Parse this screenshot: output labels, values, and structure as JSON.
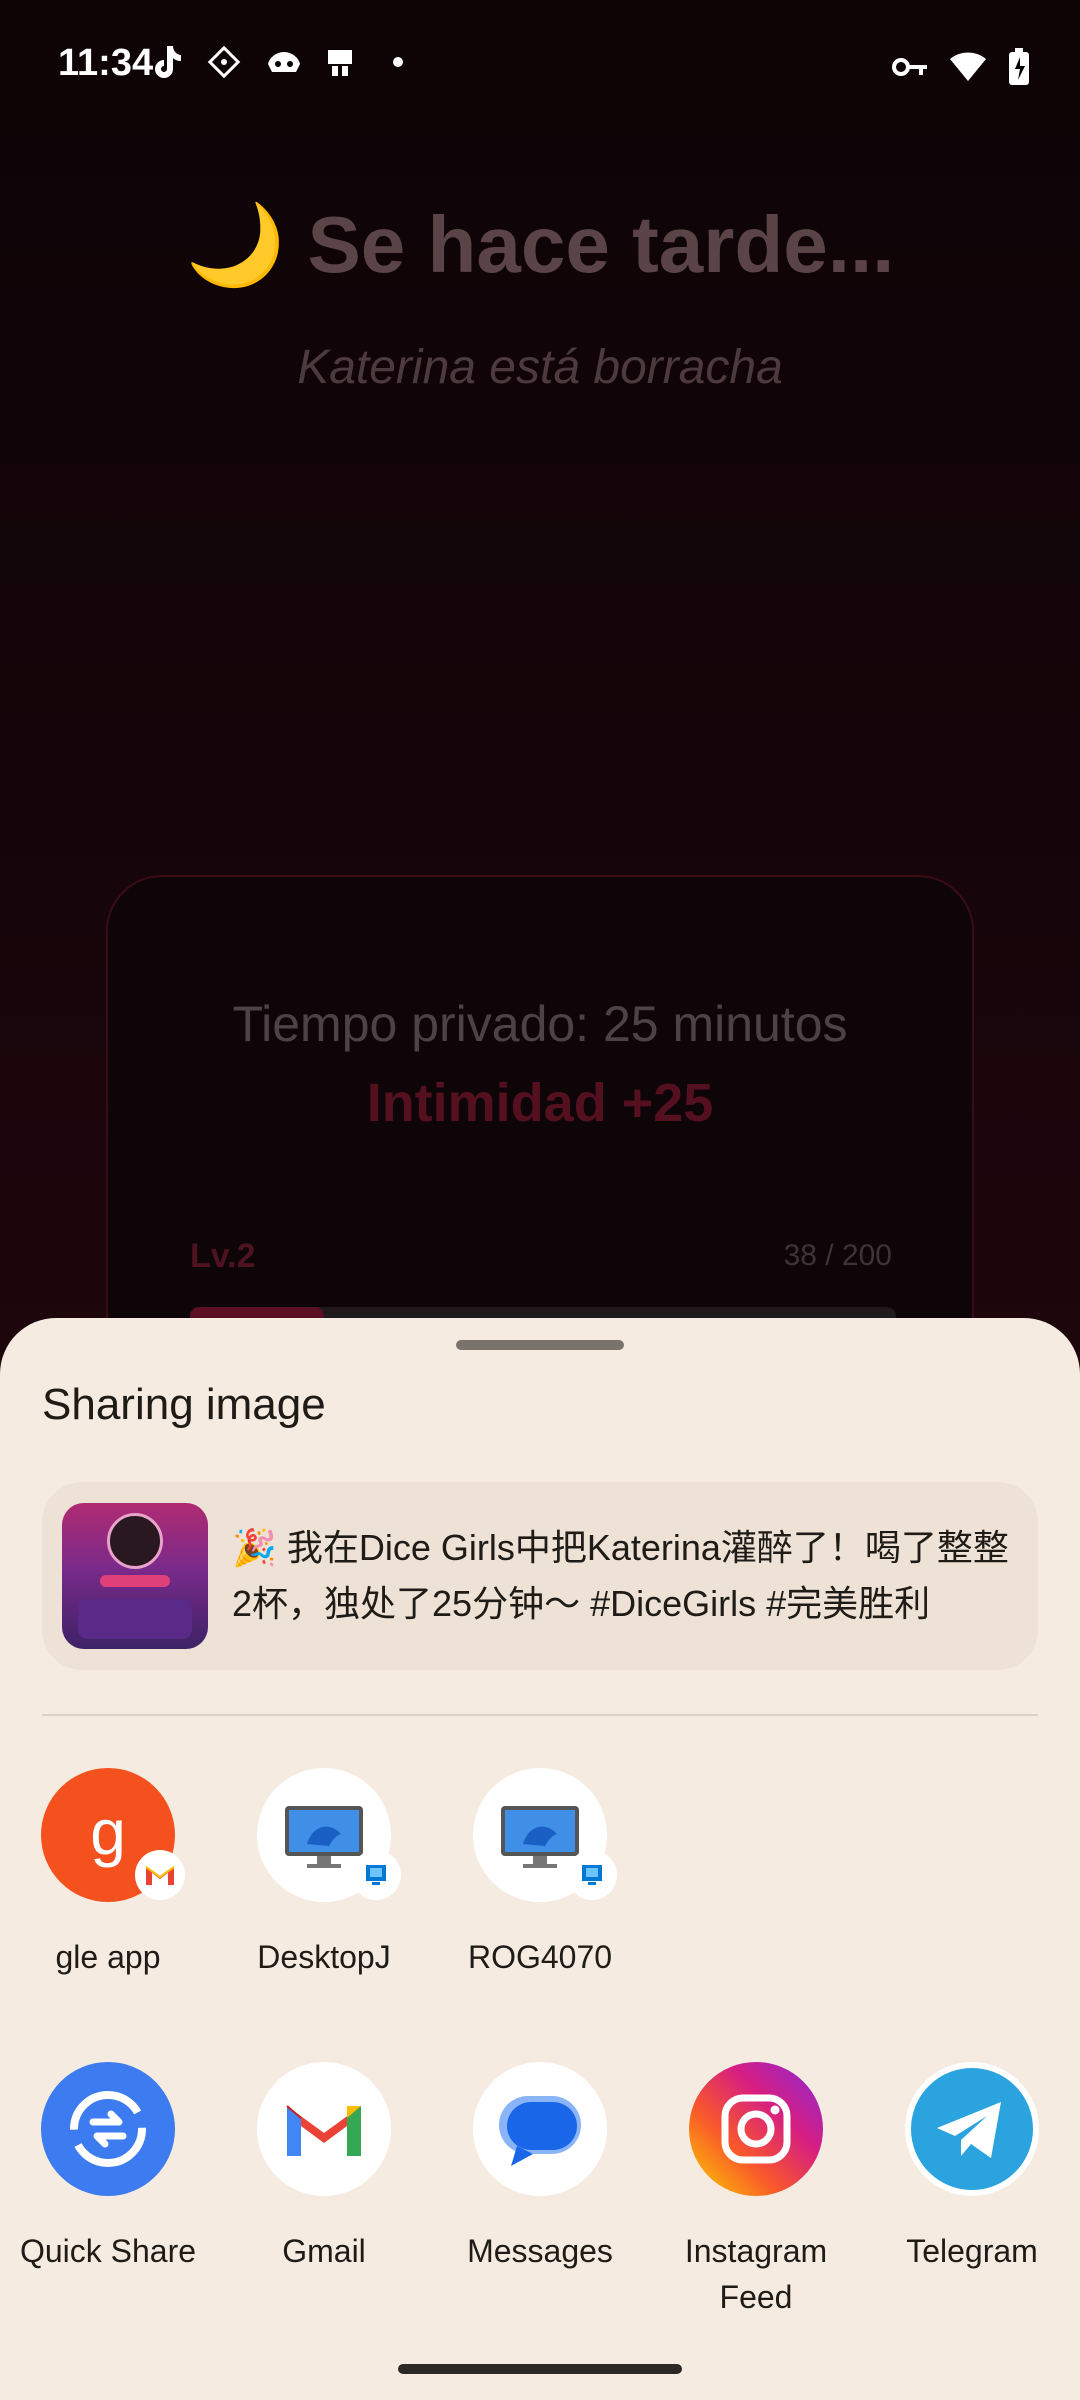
{
  "status_bar": {
    "time": "11:34",
    "left_icons": [
      "tiktok-icon",
      "grid-app-icon",
      "game-app-icon",
      "notification-app-icon",
      "dot-icon"
    ],
    "right_icons": [
      "vpn-key-icon",
      "wifi-icon",
      "battery-charging-icon"
    ]
  },
  "background_app": {
    "title_emoji": "🌙",
    "title": "Se hace tarde...",
    "subtitle": "Katerina está borracha",
    "card": {
      "line1": "Tiempo privado: 25 minutos",
      "line2": "Intimidad +25",
      "level": "Lv.2",
      "progress_text": "38 / 200",
      "progress_fraction": 0.19
    }
  },
  "share_sheet": {
    "title": "Sharing image",
    "preview_text": "🎉 我在Dice Girls中把Katerina灌醉了！喝了整整2杯，独处了25分钟～ #DiceGirls #完美胜利",
    "direct_targets": [
      {
        "label": "gle app",
        "icon": "google-app-icon",
        "badge": "gmail-badge-icon"
      },
      {
        "label": "DesktopJ",
        "icon": "desktop-icon",
        "badge": "windows-badge-icon"
      },
      {
        "label": "ROG4070",
        "icon": "desktop-icon",
        "badge": "windows-badge-icon"
      }
    ],
    "apps": [
      {
        "label": "Quick Share",
        "icon": "quick-share-icon"
      },
      {
        "label": "Gmail",
        "icon": "gmail-icon"
      },
      {
        "label": "Messages",
        "icon": "messages-icon"
      },
      {
        "label": "Instagram\nFeed",
        "icon": "instagram-icon"
      },
      {
        "label": "Telegram",
        "icon": "telegram-icon"
      }
    ]
  },
  "colors": {
    "sheet_bg": "#f5ebe0",
    "quick_share_blue": "#3d7bf0",
    "telegram_blue": "#2aa3df",
    "google_orange": "#f4511e"
  }
}
